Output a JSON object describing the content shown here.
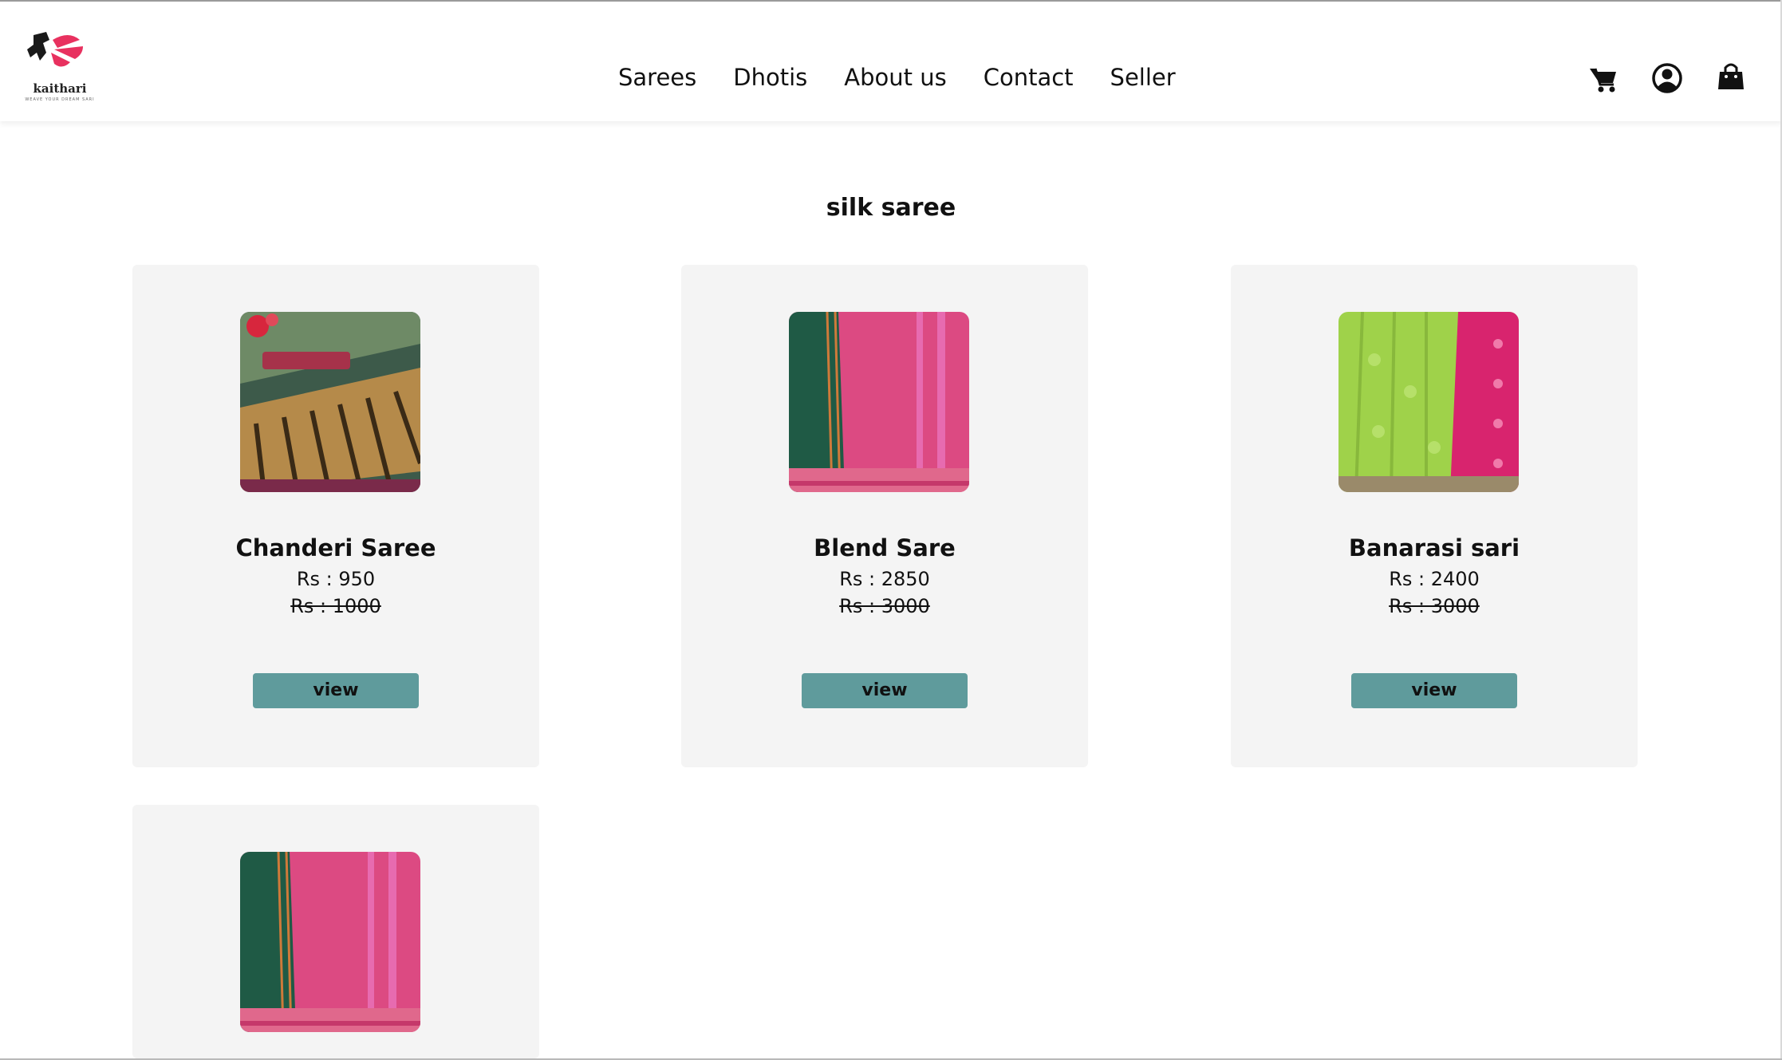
{
  "brand": {
    "name": "kaithari",
    "tagline": "WEAVE YOUR DREAM SARI"
  },
  "nav": {
    "items": [
      "Sarees",
      "Dhotis",
      "About us",
      "Contact",
      "Seller"
    ]
  },
  "header_icons": [
    "cart-icon",
    "user-account-icon",
    "shopping-bag-icon"
  ],
  "section": {
    "title": "silk saree"
  },
  "products": [
    {
      "name": "Chanderi Saree",
      "price": "Rs : 950",
      "old_price": "Rs : 1000",
      "button": "view"
    },
    {
      "name": "Blend Sare",
      "price": "Rs : 2850",
      "old_price": "Rs : 3000",
      "button": "view"
    },
    {
      "name": "Banarasi sari",
      "price": "Rs : 2400",
      "old_price": "Rs : 3000",
      "button": "view"
    },
    {
      "name": "",
      "price": "",
      "old_price": "",
      "button": ""
    }
  ],
  "colors": {
    "button": "#5f9b9c",
    "card": "#f4f4f4",
    "logo_accent": "#e8315f"
  }
}
